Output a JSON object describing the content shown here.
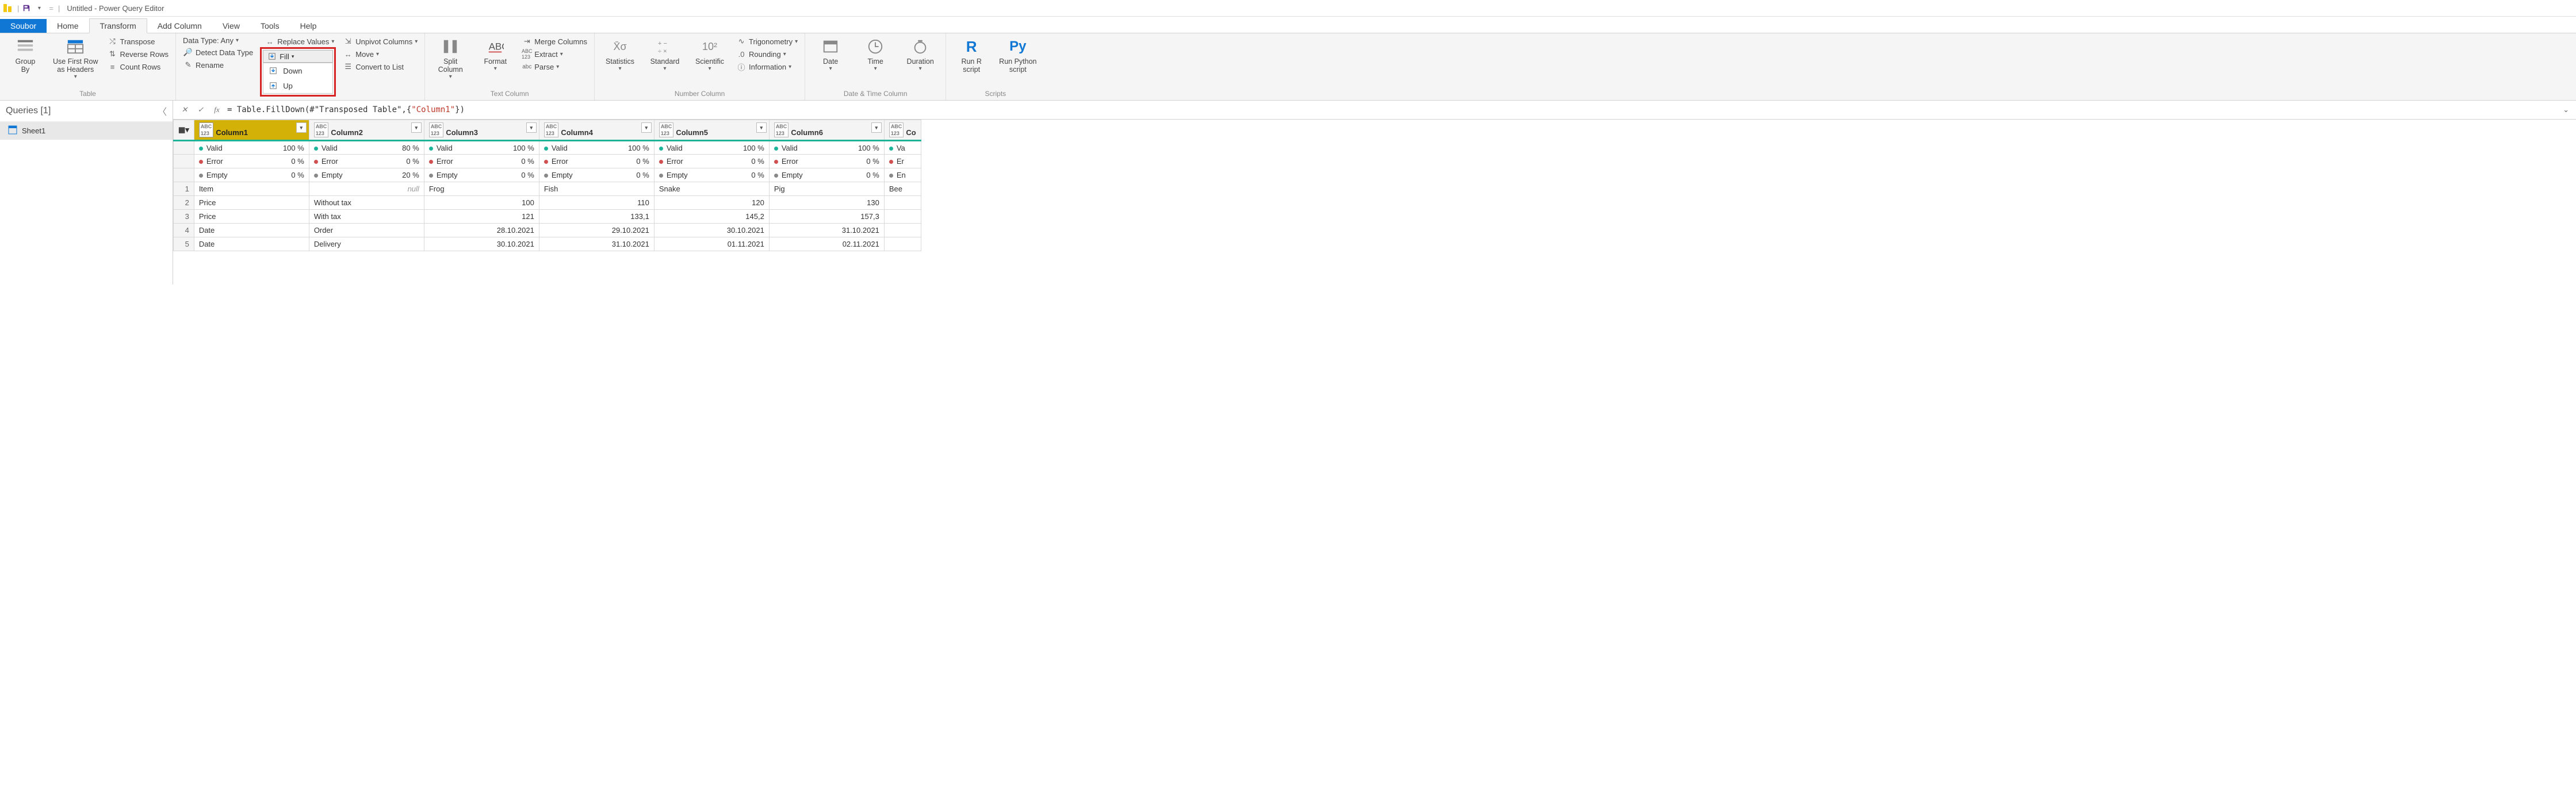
{
  "titlebar": {
    "save_tip": "Save",
    "qat_dd": "▾",
    "eq": "=",
    "title": "Untitled - Power Query Editor"
  },
  "tabs": {
    "file": "Soubor",
    "home": "Home",
    "transform": "Transform",
    "add": "Add Column",
    "view": "View",
    "tools": "Tools",
    "help": "Help"
  },
  "ribbon": {
    "table": {
      "groupby": "Group\nBy",
      "first_row": "Use First Row\nas Headers",
      "transpose": "Transpose",
      "reverse": "Reverse Rows",
      "count": "Count Rows",
      "label": "Table"
    },
    "anycol": {
      "datatype": "Data Type: Any",
      "detect": "Detect Data Type",
      "rename": "Rename",
      "replace": "Replace Values",
      "fill": "Fill",
      "fill_down": "Down",
      "fill_up": "Up",
      "unpivot": "Unpivot Columns",
      "move": "Move",
      "convert": "Convert to List"
    },
    "textcol": {
      "split": "Split\nColumn",
      "format": "Format",
      "merge": "Merge Columns",
      "extract": "Extract",
      "parse": "Parse",
      "label": "Text Column"
    },
    "numcol": {
      "stats": "Statistics",
      "standard": "Standard",
      "scientific": "Scientific",
      "trig": "Trigonometry",
      "round": "Rounding",
      "info": "Information",
      "label": "Number Column"
    },
    "datetime": {
      "date": "Date",
      "time": "Time",
      "duration": "Duration",
      "label": "Date & Time Column"
    },
    "scripts": {
      "r": "Run R\nscript",
      "py": "Run Python\nscript",
      "label": "Scripts"
    }
  },
  "queries": {
    "header": "Queries [1]",
    "item": "Sheet1"
  },
  "fx": {
    "prefix": "= Table.FillDown(#\"Transposed Table\",{",
    "literal": "\"Column1\"",
    "suffix": "})"
  },
  "columns": [
    {
      "name": "Column1",
      "valid": "100 %",
      "error": "0 %",
      "empty": "0 %"
    },
    {
      "name": "Column2",
      "valid": "80 %",
      "error": "0 %",
      "empty": "20 %"
    },
    {
      "name": "Column3",
      "valid": "100 %",
      "error": "0 %",
      "empty": "0 %"
    },
    {
      "name": "Column4",
      "valid": "100 %",
      "error": "0 %",
      "empty": "0 %"
    },
    {
      "name": "Column5",
      "valid": "100 %",
      "error": "0 %",
      "empty": "0 %"
    },
    {
      "name": "Column6",
      "valid": "100 %",
      "error": "0 %",
      "empty": "0 %"
    }
  ],
  "overflow_col": {
    "name": "Co",
    "valid": "Va",
    "error": "Er",
    "empty": "En"
  },
  "q_labels": {
    "valid": "Valid",
    "error": "Error",
    "empty": "Empty"
  },
  "rows": [
    {
      "n": "1",
      "c1": "Item",
      "c2": null,
      "c3": "Frog",
      "c4": "Fish",
      "c5": "Snake",
      "c6": "Pig",
      "c7": "Bee",
      "align": [
        "l",
        "null",
        "l",
        "l",
        "l",
        "l",
        "l"
      ]
    },
    {
      "n": "2",
      "c1": "Price",
      "c2": "Without tax",
      "c3": "100",
      "c4": "110",
      "c5": "120",
      "c6": "130",
      "c7": "",
      "align": [
        "l",
        "l",
        "r",
        "r",
        "r",
        "r",
        "r"
      ]
    },
    {
      "n": "3",
      "c1": "Price",
      "c2": "With tax",
      "c3": "121",
      "c4": "133,1",
      "c5": "145,2",
      "c6": "157,3",
      "c7": "",
      "align": [
        "l",
        "l",
        "r",
        "r",
        "r",
        "r",
        "r"
      ]
    },
    {
      "n": "4",
      "c1": "Date",
      "c2": "Order",
      "c3": "28.10.2021",
      "c4": "29.10.2021",
      "c5": "30.10.2021",
      "c6": "31.10.2021",
      "c7": "",
      "align": [
        "l",
        "l",
        "r",
        "r",
        "r",
        "r",
        "r"
      ]
    },
    {
      "n": "5",
      "c1": "Date",
      "c2": "Delivery",
      "c3": "30.10.2021",
      "c4": "31.10.2021",
      "c5": "01.11.2021",
      "c6": "02.11.2021",
      "c7": "",
      "align": [
        "l",
        "l",
        "r",
        "r",
        "r",
        "r",
        "r"
      ]
    }
  ],
  "null_text": "null"
}
